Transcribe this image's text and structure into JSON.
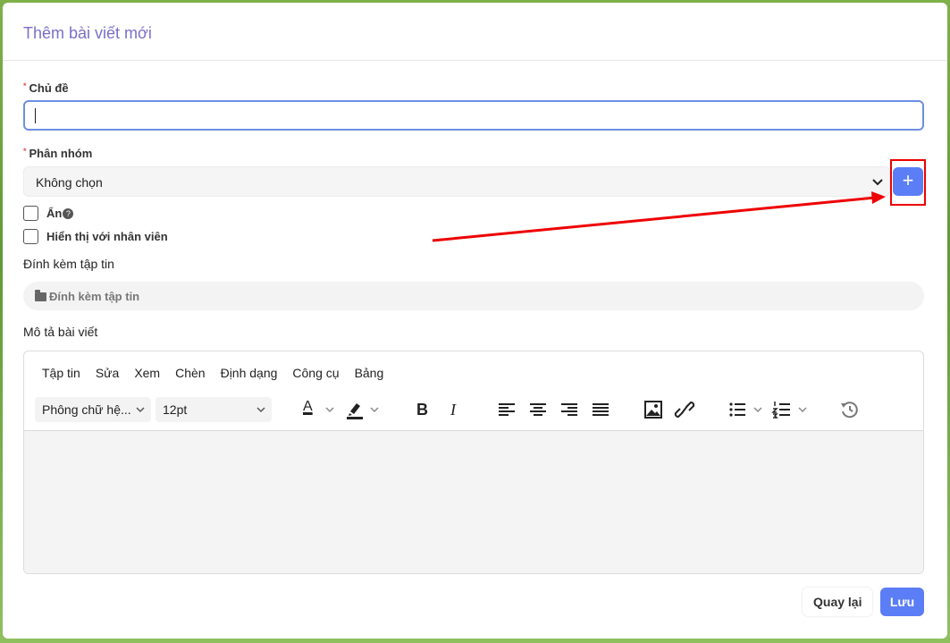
{
  "modal": {
    "title": "Thêm bài viết mới"
  },
  "subject": {
    "label": "Chủ đề",
    "required_mark": "*",
    "value": ""
  },
  "group": {
    "label": "Phân nhóm",
    "required_mark": "*",
    "selected": "Không chọn",
    "add_symbol": "+"
  },
  "options": {
    "hidden_label": "Ẩn",
    "help_symbol": "?",
    "show_staff_label": "Hiển thị với nhân viên"
  },
  "attachment": {
    "label": "Đính kèm tập tin",
    "button_label": "Đính kèm tập tin"
  },
  "description": {
    "label": "Mô tả bài viết",
    "menu": [
      "Tập tin",
      "Sửa",
      "Xem",
      "Chèn",
      "Định dạng",
      "Công cụ",
      "Bảng"
    ],
    "font_family": "Phông chữ hệ...",
    "font_size": "12pt",
    "text_color_letter": "A",
    "bold_letter": "B",
    "italic_letter": "I"
  },
  "footer": {
    "back_label": "Quay lại",
    "save_label": "Lưu"
  },
  "colors": {
    "accent": "#5b7df5",
    "title": "#7a6fc9",
    "annotation": "#e00000"
  }
}
